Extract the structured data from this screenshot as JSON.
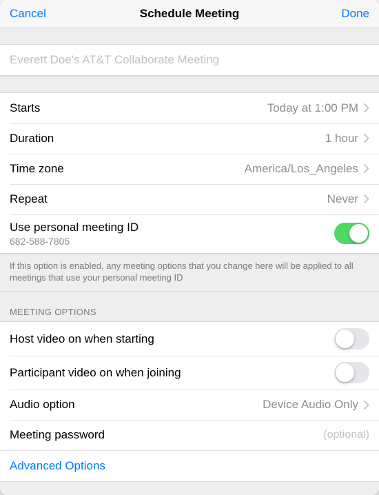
{
  "header": {
    "cancel": "Cancel",
    "title": "Schedule Meeting",
    "done": "Done"
  },
  "titleField": {
    "placeholder": "Everett Doe's AT&T Collaborate Meeting"
  },
  "schedule": {
    "startsLabel": "Starts",
    "startsValue": "Today at 1:00 PM",
    "durationLabel": "Duration",
    "durationValue": "1 hour",
    "timezoneLabel": "Time zone",
    "timezoneValue": "America/Los_Angeles",
    "repeatLabel": "Repeat",
    "repeatValue": "Never",
    "pmiLabel": "Use personal meeting ID",
    "pmiValue": "682-588-7805",
    "pmiOn": true,
    "footer": "If this option is enabled, any meeting options that you change here will be applied to all meetings that use your personal meeting ID"
  },
  "optionsHeader": "MEETING OPTIONS",
  "options": {
    "hostVideoLabel": "Host video on when starting",
    "hostVideoOn": false,
    "participantVideoLabel": "Participant video on when joining",
    "participantVideoOn": false,
    "audioLabel": "Audio option",
    "audioValue": "Device Audio Only",
    "passwordLabel": "Meeting password",
    "passwordPlaceholder": "(optional)",
    "advancedLabel": "Advanced Options"
  }
}
